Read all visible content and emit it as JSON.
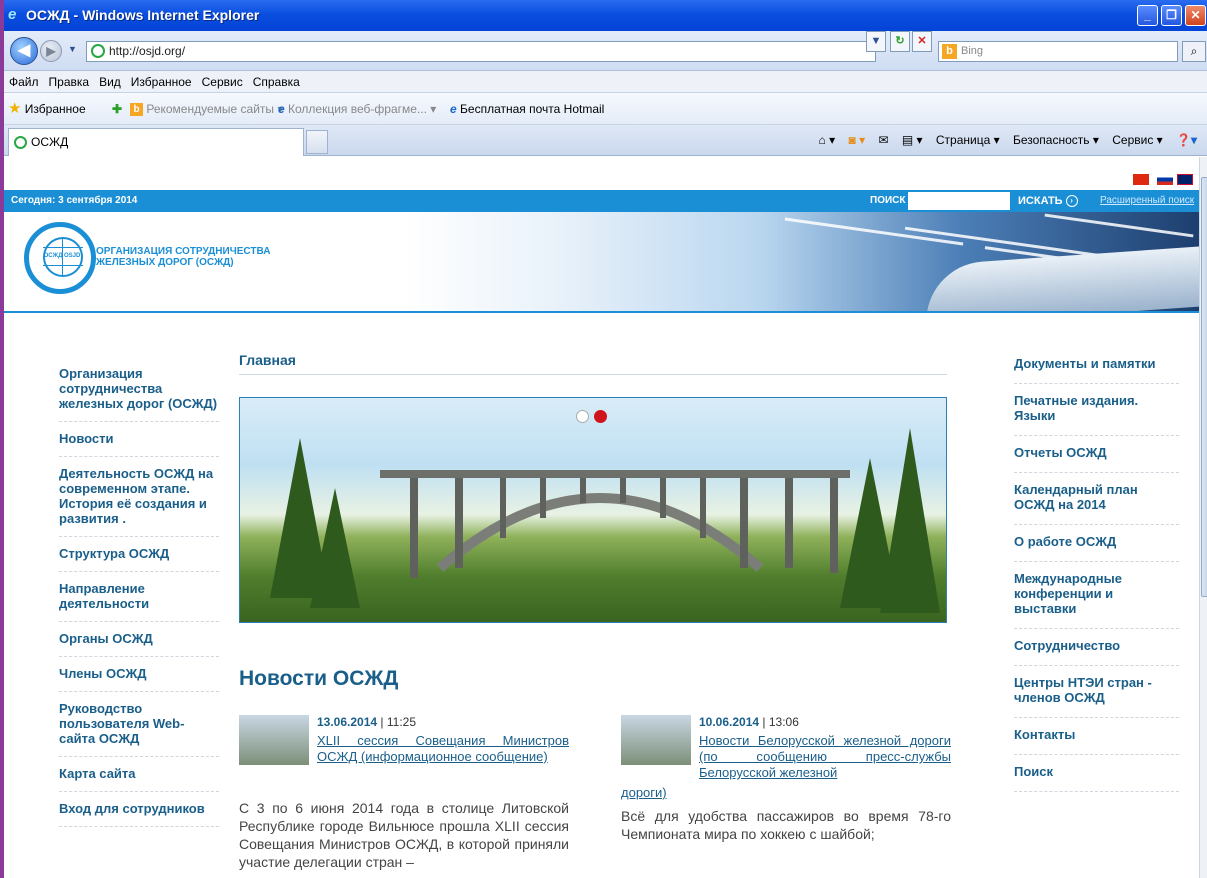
{
  "window": {
    "title": "ОСЖД - Windows Internet Explorer",
    "ie_logo_glyph": "e",
    "minimize_glyph": "_",
    "maximize_glyph": "❐",
    "close_glyph": "✕"
  },
  "addressbar": {
    "url": "http://osjd.org/",
    "search_placeholder": "Bing",
    "search_logo_glyph": "b",
    "back_glyph": "◀",
    "forward_glyph": "▶",
    "dropdown_glyph": "▼",
    "refresh_glyph": "↻",
    "stop_glyph": "✕",
    "search_glyph": "⌕"
  },
  "menu": [
    "Файл",
    "Правка",
    "Вид",
    "Избранное",
    "Сервис",
    "Справка"
  ],
  "favorites": {
    "favorites_label": "Избранное",
    "star_glyph": "★",
    "add_glyph": "✚",
    "suggested_glyph": "b",
    "page_glyph": "e",
    "dropdown_glyph": "▾",
    "items": [
      "Рекомендуемые сайты ▾",
      "Коллекция веб-фрагме... ▾",
      "Бесплатная почта Hotmail"
    ]
  },
  "tab": {
    "label": "ОСЖД"
  },
  "commandbar": {
    "home_glyph": "⌂ ▾",
    "feeds_glyph": "◙ ▾",
    "mail_glyph": "✉",
    "print_glyph": "▤ ▾",
    "help_glyph": "❓▾",
    "page_label": "Страница ▾",
    "safety_label": "Безопасность ▾",
    "tools_label": "Сервис ▾"
  },
  "site": {
    "today": "Сегодня: 3 сентября 2014",
    "search_label": "ПОИСК",
    "search_button": "ИСКАТЬ",
    "search_button_glyph": "›",
    "advanced_search": "Расширенный поиск",
    "org_name_line1": "ОРГАНИЗАЦИЯ СОТРУДНИЧЕСТВА",
    "org_name_line2": "ЖЕЛЕЗНЫХ ДОРОГ (ОСЖД)",
    "logo_text": "ОСЖД OSJD",
    "main_title": "Главная",
    "news_heading": "Новости ОСЖД",
    "left_nav": [
      "Организация сотрудничества железных дорог (ОСЖД)",
      "Новости",
      "Деятельность ОСЖД на современном этапе. История её создания и развития .",
      "Структура ОСЖД",
      "Направление деятельности",
      "Органы ОСЖД",
      "Члены ОСЖД",
      "Руководство пользователя Web-сайта ОСЖД",
      "Карта сайта",
      "Вход для сотрудников"
    ],
    "right_nav": [
      "Документы и памятки",
      "Печатные издания. Языки",
      "Отчеты ОСЖД",
      "Календарный план ОСЖД на 2014",
      "О работе ОСЖД",
      "Международные конференции и выставки",
      "Сотрудничество",
      "Центры НТЭИ стран - членов ОСЖД",
      "Контакты",
      "Поиск"
    ],
    "news": [
      {
        "date": "13.06.2014",
        "time": "| 11:25",
        "title": "XLII сессия Совещания Министров ОСЖД (информационное сообщение)",
        "title_tail": "",
        "body": "С 3 по 6 июня 2014 года в столице Литовской Республике городе Вильнюсе прошла XLII сессия Совещания Министров ОСЖД, в которой приняли участие делегации стран –"
      },
      {
        "date": "10.06.2014",
        "time": "| 13:06",
        "title": "Новости Белорусской железной дороги (по сообщению пресс-службы Белорусской железной",
        "title_tail": "дороги)",
        "body": "Всё для удобства пассажиров во время 78-го Чемпионата мира по хоккею с шайбой;"
      }
    ]
  }
}
